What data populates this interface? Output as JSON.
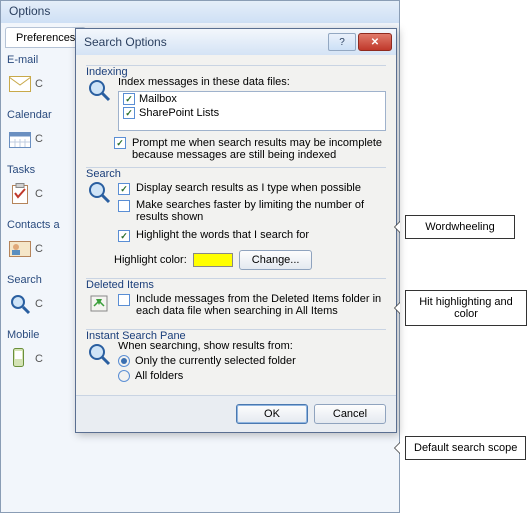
{
  "options_window": {
    "title": "Options",
    "tab": "Preferences",
    "sections": {
      "email": "E-mail",
      "calendar": "Calendar",
      "tasks": "Tasks",
      "contacts": "Contacts a",
      "search": "Search",
      "mobile": "Mobile",
      "c": "C"
    }
  },
  "dialog": {
    "title": "Search Options",
    "indexing": {
      "label": "Indexing",
      "caption": "Index messages in these data files:",
      "items": [
        "Mailbox",
        "SharePoint Lists"
      ],
      "prompt": "Prompt me when search results may be incomplete because messages are still being indexed"
    },
    "search": {
      "label": "Search",
      "wordwheel": "Display search results as I type when possible",
      "faster": "Make searches faster by limiting the number of results shown",
      "highlight": "Highlight the words that I search for",
      "color_label": "Highlight color:",
      "change_btn": "Change..."
    },
    "deleted": {
      "label": "Deleted Items",
      "include": "Include messages from the Deleted Items folder in each data file when searching in All Items"
    },
    "pane": {
      "label": "Instant Search Pane",
      "caption": "When searching, show results from:",
      "opt1": "Only the currently selected folder",
      "opt2": "All folders"
    },
    "buttons": {
      "ok": "OK",
      "cancel": "Cancel"
    }
  },
  "callouts": {
    "wordwheel": "Wordwheeling",
    "highlight": "Hit highlighting and color",
    "scope": "Default search scope"
  }
}
